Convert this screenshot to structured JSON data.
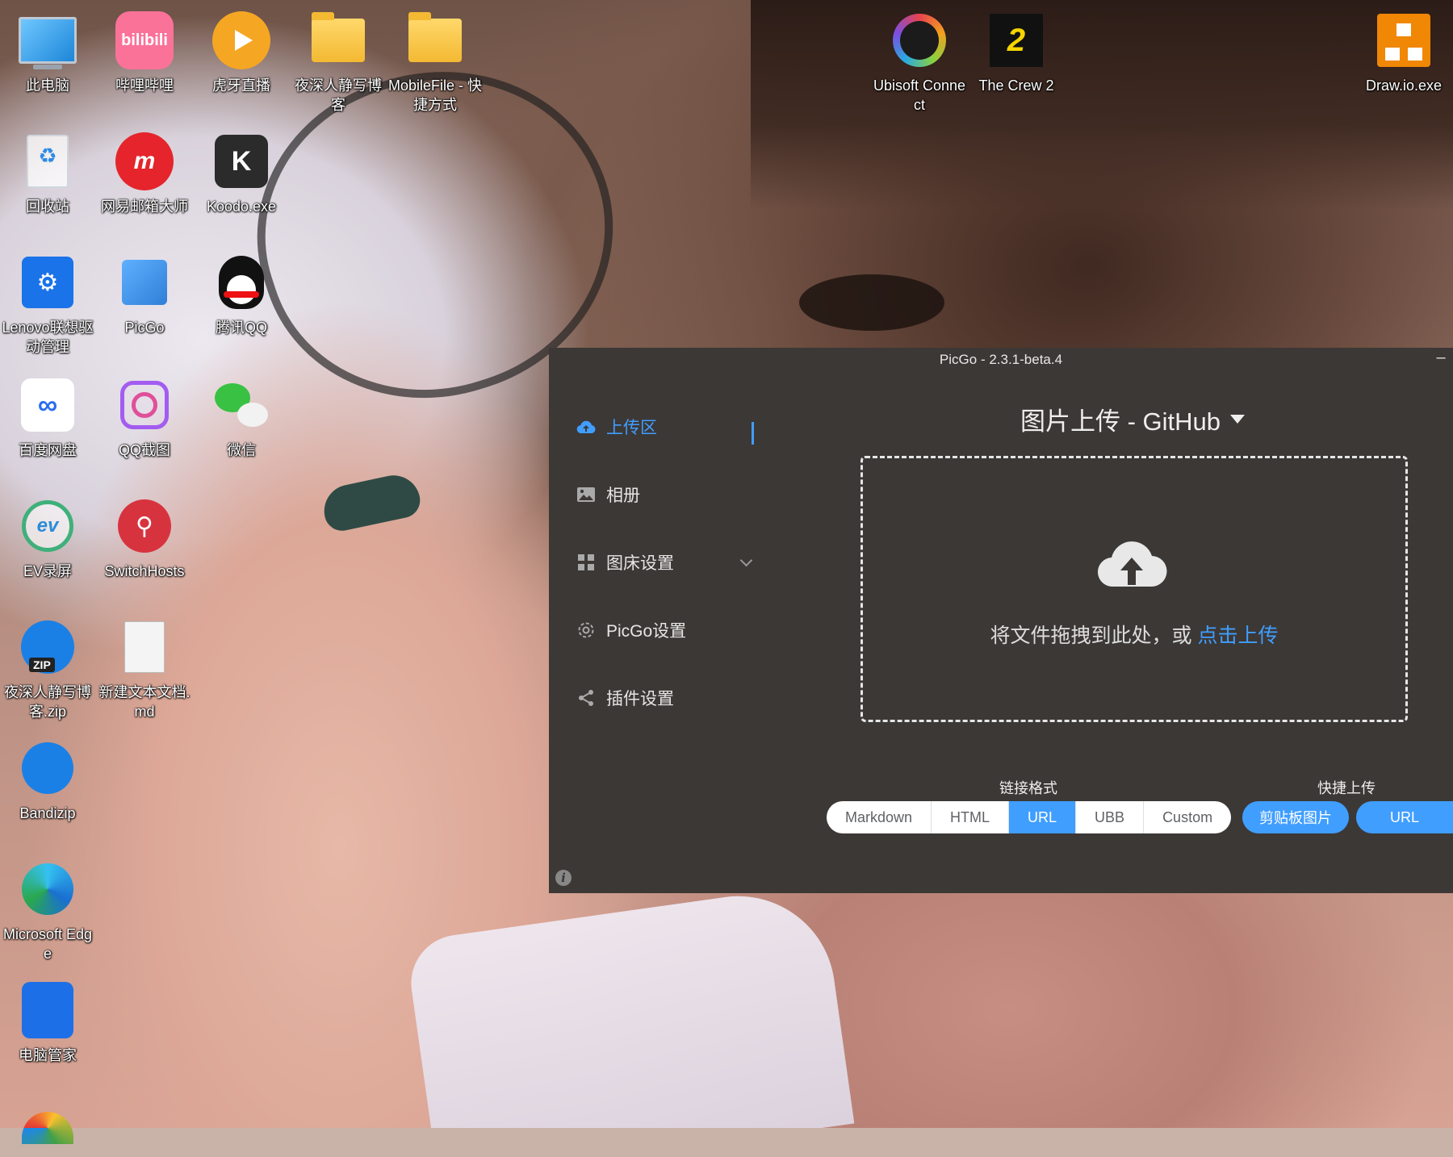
{
  "desktop": {
    "icons": [
      {
        "label": "此电脑",
        "icon": "computer-icon"
      },
      {
        "label": "哔哩哔哩",
        "icon": "bilibili-icon",
        "glyph": "bilibili"
      },
      {
        "label": "虎牙直播",
        "icon": "huya-icon"
      },
      {
        "label": "夜深人静写博客",
        "icon": "folder-icon"
      },
      {
        "label": "MobileFile - 快捷方式",
        "icon": "folder-icon"
      },
      {
        "label": "回收站",
        "icon": "recycle-bin-icon"
      },
      {
        "label": "网易邮箱大师",
        "icon": "netease-mail-icon",
        "glyph": "m"
      },
      {
        "label": "Koodo.exe",
        "icon": "koodo-reader-icon",
        "glyph": "K"
      },
      {
        "label": "Lenovo联想驱动管理",
        "icon": "lenovo-driver-icon",
        "glyph": "⚙"
      },
      {
        "label": "PicGo",
        "icon": "picgo-icon"
      },
      {
        "label": "腾讯QQ",
        "icon": "qq-penguin-icon"
      },
      {
        "label": "百度网盘",
        "icon": "baidu-netdisk-icon",
        "glyph": "∞"
      },
      {
        "label": "QQ截图",
        "icon": "qq-screenshot-icon"
      },
      {
        "label": "微信",
        "icon": "wechat-icon"
      },
      {
        "label": "EV录屏",
        "icon": "ev-recorder-icon",
        "glyph": "ev"
      },
      {
        "label": "SwitchHosts",
        "icon": "switchhosts-icon",
        "glyph": "⚲"
      },
      {
        "label": "夜深人静写博客.zip",
        "icon": "bandizip-archive-icon"
      },
      {
        "label": "新建文本文档.md",
        "icon": "markdown-file-icon"
      },
      {
        "label": "Bandizip",
        "icon": "bandizip-icon"
      },
      {
        "label": "Microsoft Edge",
        "icon": "edge-icon"
      },
      {
        "label": "电脑管家",
        "icon": "pc-manager-icon"
      },
      {
        "label": "Ubisoft Connect",
        "icon": "ubisoft-icon"
      },
      {
        "label": "The Crew 2",
        "icon": "the-crew-2-icon",
        "glyph": "2"
      },
      {
        "label": "Draw.io.exe",
        "icon": "drawio-icon"
      }
    ]
  },
  "picgo": {
    "title": "PicGo - 2.3.1-beta.4",
    "minimize_label": "–",
    "nav": [
      {
        "label": "上传区",
        "icon": "upload-cloud-icon",
        "active": true
      },
      {
        "label": "相册",
        "icon": "image-icon"
      },
      {
        "label": "图床设置",
        "icon": "grid-icon"
      },
      {
        "label": "PicGo设置",
        "icon": "settings-gear-icon"
      },
      {
        "label": "插件设置",
        "icon": "share-icon"
      }
    ],
    "main_title": "图片上传 - GitHub",
    "dropzone": {
      "text": "将文件拖拽到此处，或 ",
      "link": "点击上传"
    },
    "link_format": {
      "label": "链接格式",
      "options": [
        "Markdown",
        "HTML",
        "URL",
        "UBB",
        "Custom"
      ],
      "selected": "URL"
    },
    "quick_upload": {
      "label": "快捷上传",
      "clipboard_button": "剪贴板图片",
      "url_button": "URL"
    },
    "info_glyph": "i",
    "accent_color": "#409eff",
    "background_color": "#3c3836"
  }
}
